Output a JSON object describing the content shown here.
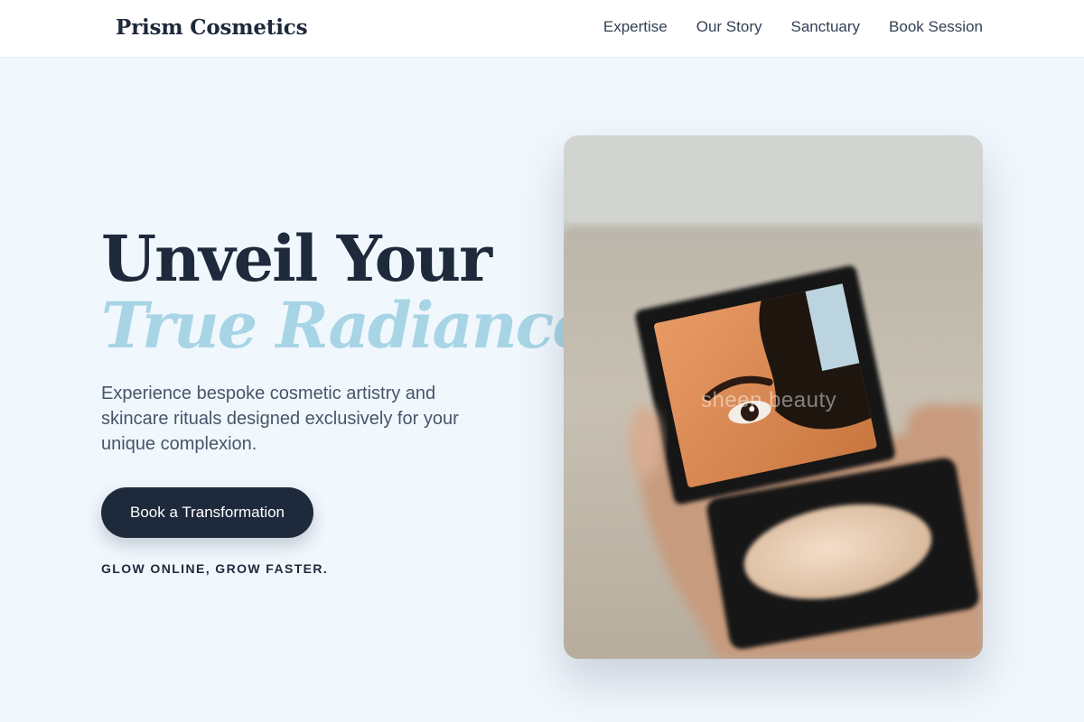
{
  "nav": {
    "brand": "Prism Cosmetics",
    "links": [
      "Expertise",
      "Our Story",
      "Sanctuary",
      "Book Session"
    ]
  },
  "hero": {
    "headline_line1": "Unveil Your",
    "headline_line2": "True Radiance",
    "subtitle": "Experience bespoke cosmetic artistry and skincare rituals designed exclusively for your unique complexion.",
    "cta_label": "Book a Transformation",
    "tagline": "GLOW ONLINE, GROW FASTER."
  },
  "image": {
    "watermark": "sheen beauty",
    "icon": "compact-mirror-photo"
  },
  "colors": {
    "primary": "#1e293b",
    "accent": "#a8d5e5",
    "background": "#f0f7fd"
  }
}
